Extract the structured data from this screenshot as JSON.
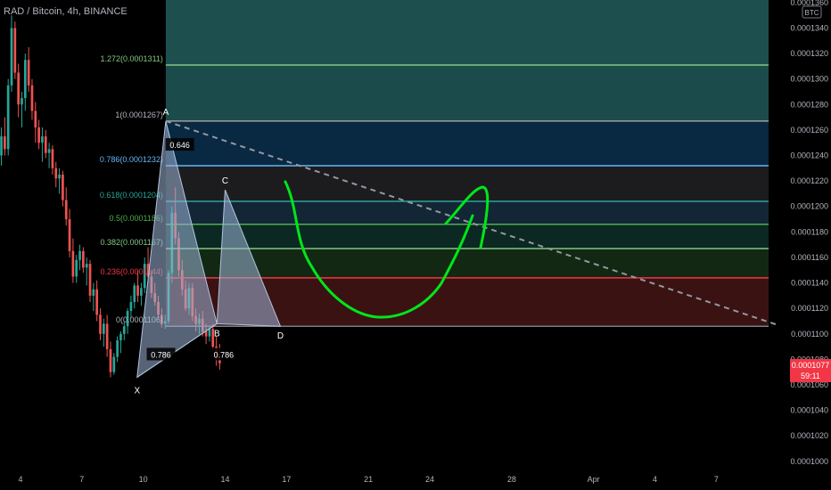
{
  "header": {
    "symbol_title": "RAD / Bitcoin, 4h, BINANCE"
  },
  "currency_badge": "BTC",
  "price_tag": {
    "price": "0.0001077",
    "countdown": "59:11",
    "color": "#f23645"
  },
  "chart_data": {
    "type": "candlestick",
    "title": "RAD / Bitcoin, 4h, BINANCE",
    "y_range": [
      9.95e-05,
      0.0001362
    ],
    "y_ticks": [
      "0.0001000",
      "0.0001020",
      "0.0001040",
      "0.0001060",
      "0.0001080",
      "0.0001100",
      "0.0001120",
      "0.0001140",
      "0.0001160",
      "0.0001180",
      "0.0001200",
      "0.0001220",
      "0.0001240",
      "0.0001260",
      "0.0001280",
      "0.0001300",
      "0.0001320",
      "0.0001340",
      "0.0001360"
    ],
    "x_ticks": [
      "4",
      "7",
      "10",
      "14",
      "17",
      "21",
      "24",
      "28",
      "Apr",
      "4",
      "7"
    ],
    "x_tick_days": [
      4,
      7,
      10,
      14,
      17,
      21,
      24,
      28,
      32,
      35,
      38
    ],
    "x_range_days": [
      3.0,
      41.6
    ],
    "candle_start_day": 2.9,
    "candle_step_days": 0.1667,
    "candles": [
      [
        0.0001215,
        0.0001248,
        0.0001205,
        0.000124
      ],
      [
        0.000124,
        0.0001262,
        0.0001232,
        0.0001255
      ],
      [
        0.0001255,
        0.000127,
        0.000124,
        0.0001245
      ],
      [
        0.0001245,
        0.00013,
        0.000124,
        0.0001295
      ],
      [
        0.0001295,
        0.000135,
        0.000129,
        0.000134
      ],
      [
        0.000134,
        0.0001345,
        0.00013,
        0.0001305
      ],
      [
        0.0001305,
        0.0001312,
        0.000127,
        0.000128
      ],
      [
        0.000128,
        0.000129,
        0.0001262,
        0.0001285
      ],
      [
        0.0001285,
        0.000132,
        0.0001275,
        0.0001315
      ],
      [
        0.0001315,
        0.0001325,
        0.000129,
        0.0001295
      ],
      [
        0.0001295,
        0.00013,
        0.0001268,
        0.0001275
      ],
      [
        0.0001275,
        0.0001282,
        0.000125,
        0.0001262
      ],
      [
        0.0001262,
        0.0001268,
        0.0001245,
        0.000125
      ],
      [
        0.000125,
        0.0001262,
        0.0001235,
        0.0001255
      ],
      [
        0.0001255,
        0.000126,
        0.0001238,
        0.0001242
      ],
      [
        0.0001242,
        0.000125,
        0.000123,
        0.0001245
      ],
      [
        0.0001245,
        0.0001248,
        0.0001225,
        0.000123
      ],
      [
        0.000123,
        0.0001235,
        0.0001215,
        0.0001222
      ],
      [
        0.0001222,
        0.000123,
        0.000121,
        0.0001225
      ],
      [
        0.0001225,
        0.0001228,
        0.00012,
        0.0001205
      ],
      [
        0.0001205,
        0.0001215,
        0.0001185,
        0.000119
      ],
      [
        0.000119,
        0.0001198,
        0.000116,
        0.0001165
      ],
      [
        0.0001165,
        0.0001175,
        0.000114,
        0.0001145
      ],
      [
        0.0001145,
        0.0001162,
        0.000114,
        0.0001158
      ],
      [
        0.0001158,
        0.000117,
        0.000115,
        0.0001165
      ],
      [
        0.0001165,
        0.0001168,
        0.0001148,
        0.0001152
      ],
      [
        0.0001152,
        0.000116,
        0.0001138,
        0.0001155
      ],
      [
        0.0001155,
        0.0001158,
        0.0001125,
        0.000113
      ],
      [
        0.000113,
        0.000114,
        0.0001118,
        0.0001135
      ],
      [
        0.0001135,
        0.0001142,
        0.000111,
        0.0001115
      ],
      [
        0.0001115,
        0.000112,
        0.0001095,
        0.00011
      ],
      [
        0.00011,
        0.0001112,
        0.000109,
        0.0001108
      ],
      [
        0.0001108,
        0.0001115,
        0.0001082,
        0.0001088
      ],
      [
        0.0001088,
        0.0001094,
        0.0001066,
        0.000107
      ],
      [
        0.000107,
        0.0001085,
        0.0001068,
        0.0001082
      ],
      [
        0.0001082,
        0.0001098,
        0.0001078,
        0.0001095
      ],
      [
        0.0001095,
        0.0001102,
        0.0001085,
        0.00011
      ],
      [
        0.00011,
        0.000111,
        0.0001095,
        0.0001106
      ],
      [
        0.0001106,
        0.000112,
        0.00011,
        0.0001118
      ],
      [
        0.0001118,
        0.000113,
        0.0001112,
        0.0001125
      ],
      [
        0.0001125,
        0.000114,
        0.000112,
        0.0001138
      ],
      [
        0.0001138,
        0.000115,
        0.0001125,
        0.000113
      ],
      [
        0.000113,
        0.000114,
        0.0001122,
        0.0001136
      ],
      [
        0.0001136,
        0.000116,
        0.0001132,
        0.0001155
      ],
      [
        0.0001155,
        0.0001168,
        0.000114,
        0.0001145
      ],
      [
        0.0001145,
        0.000115,
        0.0001128,
        0.0001132
      ],
      [
        0.0001132,
        0.000114,
        0.0001122,
        0.0001125
      ],
      [
        0.0001125,
        0.000113,
        0.0001112,
        0.0001115
      ],
      [
        0.0001115,
        0.000112,
        0.0001105,
        0.0001108
      ],
      [
        0.0001108,
        0.0001115,
        0.0001104,
        0.000111
      ],
      [
        0.000111,
        0.000115,
        0.0001108,
        0.0001148
      ],
      [
        0.0001148,
        0.00012,
        0.000114,
        0.0001195
      ],
      [
        0.0001195,
        0.0001215,
        0.000117,
        0.0001175
      ],
      [
        0.0001175,
        0.000118,
        0.0001145,
        0.000115
      ],
      [
        0.000115,
        0.0001158,
        0.000113,
        0.0001135
      ],
      [
        0.0001135,
        0.0001142,
        0.0001118,
        0.000112
      ],
      [
        0.000112,
        0.000114,
        0.0001115,
        0.0001136
      ],
      [
        0.0001136,
        0.000114,
        0.000111,
        0.0001114
      ],
      [
        0.0001114,
        0.000112,
        0.0001102,
        0.0001108
      ],
      [
        0.0001108,
        0.0001116,
        0.00011,
        0.0001112
      ],
      [
        0.0001112,
        0.0001118,
        0.0001098,
        0.0001102
      ],
      [
        0.0001102,
        0.0001108,
        0.0001092,
        0.0001098
      ],
      [
        0.0001098,
        0.0001106,
        0.0001094,
        0.0001104
      ],
      [
        0.0001104,
        0.0001108,
        0.0001086,
        0.000109
      ],
      [
        0.000109,
        0.0001098,
        0.0001075,
        0.000108
      ],
      [
        0.000108,
        0.0001092,
        0.0001072,
        0.0001077
      ]
    ],
    "fib_levels": [
      {
        "label": "1.272(0.0001311)",
        "price": 0.0001311,
        "line_color": "#81c784",
        "label_color": "#81c784",
        "zone_color": "#1e4f4f"
      },
      {
        "label": "1(0.0001267)",
        "price": 0.0001267,
        "line_color": "#9e9e9e",
        "label_color": "#b2b5be",
        "zone_color": "#0a2a44"
      },
      {
        "label": "0.786(0.0001232)",
        "price": 0.0001232,
        "line_color": "#64b5f6",
        "label_color": "#64b5f6",
        "zone_color": "#1d1d20"
      },
      {
        "label": "0.618(0.0001204)",
        "price": 0.0001204,
        "line_color": "#26a69a",
        "label_color": "#26a69a",
        "zone_color": "#132838"
      },
      {
        "label": "0.5(0.0001186)",
        "price": 0.0001186,
        "line_color": "#4caf50",
        "label_color": "#4caf50",
        "zone_color": "#0c2a24"
      },
      {
        "label": "0.382(0.0001167)",
        "price": 0.0001167,
        "line_color": "#81c784",
        "label_color": "#81c784",
        "zone_color": "#132a14"
      },
      {
        "label": "0.236(0.0001144)",
        "price": 0.0001144,
        "line_color": "#f23645",
        "label_color": "#f23645",
        "zone_color": "#1f2510"
      },
      {
        "label": "0(0.0001106)",
        "price": 0.0001106,
        "line_color": "#787b86",
        "label_color": "#b2b5be",
        "zone_color": "#3a1212"
      }
    ],
    "pattern_points": [
      {
        "name": "X",
        "day": 9.7,
        "price": 0.0001066
      },
      {
        "name": "A",
        "day": 11.1,
        "price": 0.0001267
      },
      {
        "name": "B",
        "day": 13.6,
        "price": 0.0001108
      },
      {
        "name": "C",
        "day": 14.0,
        "price": 0.0001213
      },
      {
        "name": "D",
        "day": 16.7,
        "price": 0.0001106
      }
    ],
    "pattern_ratios": [
      "0.786",
      "0.786",
      "0.646"
    ],
    "trend_line": {
      "from_day": 11.1,
      "from_price": 0.0001267,
      "to_day": 41.0,
      "to_price": 0.0001107
    },
    "drawing_color": "#00e61a",
    "up_color": "#26a69a",
    "down_color": "#ef5350"
  }
}
